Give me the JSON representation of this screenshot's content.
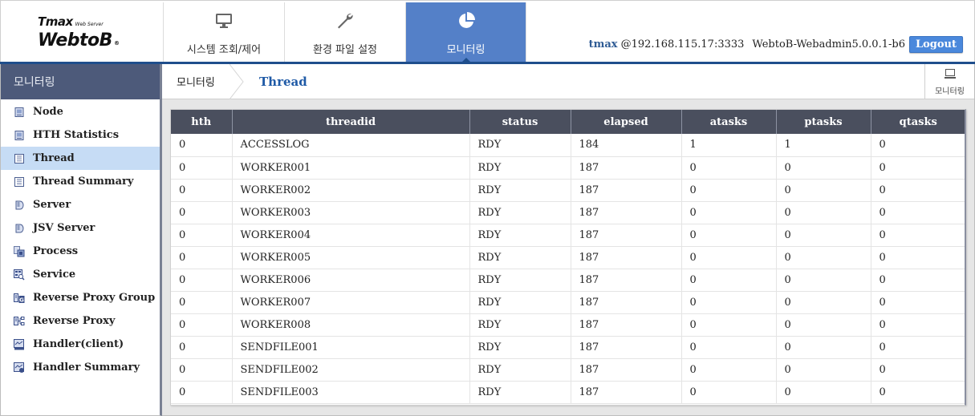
{
  "logo": {
    "brand": "Tmax",
    "tagline": "Web Server",
    "product": "WebtoB",
    "mark": "®"
  },
  "nav": {
    "tabs": [
      {
        "label": "시스템 조회/제어",
        "icon": "monitor-icon",
        "active": false
      },
      {
        "label": "환경 파일 설정",
        "icon": "wrench-icon",
        "active": false
      },
      {
        "label": "모니터링",
        "icon": "pie-chart-icon",
        "active": true
      }
    ]
  },
  "userinfo": {
    "user": "tmax",
    "host": "@192.168.115.17:3333",
    "version": "WebtoB-Webadmin5.0.0.1-b6",
    "logout_label": "Logout"
  },
  "sidebar": {
    "title": "모니터링",
    "items": [
      {
        "label": "Node",
        "icon": "node-icon",
        "active": false
      },
      {
        "label": "HTH Statistics",
        "icon": "hth-statistics-icon",
        "active": false
      },
      {
        "label": "Thread",
        "icon": "thread-icon",
        "active": true
      },
      {
        "label": "Thread Summary",
        "icon": "thread-summary-icon",
        "active": false
      },
      {
        "label": "Server",
        "icon": "server-icon",
        "active": false
      },
      {
        "label": "JSV Server",
        "icon": "jsv-server-icon",
        "active": false
      },
      {
        "label": "Process",
        "icon": "process-icon",
        "active": false
      },
      {
        "label": "Service",
        "icon": "service-icon",
        "active": false
      },
      {
        "label": "Reverse Proxy Group",
        "icon": "reverse-proxy-group-icon",
        "active": false
      },
      {
        "label": "Reverse Proxy",
        "icon": "reverse-proxy-icon",
        "active": false
      },
      {
        "label": "Handler(client)",
        "icon": "handler-client-icon",
        "active": false
      },
      {
        "label": "Handler Summary",
        "icon": "handler-summary-icon",
        "active": false
      }
    ]
  },
  "breadcrumb": {
    "root": "모니터링",
    "current": "Thread"
  },
  "monitor_button": {
    "label": "모니터링",
    "icon": "monitor-icon"
  },
  "table": {
    "columns": [
      "hth",
      "threadid",
      "status",
      "elapsed",
      "atasks",
      "ptasks",
      "qtasks"
    ],
    "rows": [
      [
        "0",
        "ACCESSLOG",
        "RDY",
        "184",
        "1",
        "1",
        "0"
      ],
      [
        "0",
        "WORKER001",
        "RDY",
        "187",
        "0",
        "0",
        "0"
      ],
      [
        "0",
        "WORKER002",
        "RDY",
        "187",
        "0",
        "0",
        "0"
      ],
      [
        "0",
        "WORKER003",
        "RDY",
        "187",
        "0",
        "0",
        "0"
      ],
      [
        "0",
        "WORKER004",
        "RDY",
        "187",
        "0",
        "0",
        "0"
      ],
      [
        "0",
        "WORKER005",
        "RDY",
        "187",
        "0",
        "0",
        "0"
      ],
      [
        "0",
        "WORKER006",
        "RDY",
        "187",
        "0",
        "0",
        "0"
      ],
      [
        "0",
        "WORKER007",
        "RDY",
        "187",
        "0",
        "0",
        "0"
      ],
      [
        "0",
        "WORKER008",
        "RDY",
        "187",
        "0",
        "0",
        "0"
      ],
      [
        "0",
        "SENDFILE001",
        "RDY",
        "187",
        "0",
        "0",
        "0"
      ],
      [
        "0",
        "SENDFILE002",
        "RDY",
        "187",
        "0",
        "0",
        "0"
      ],
      [
        "0",
        "SENDFILE003",
        "RDY",
        "187",
        "0",
        "0",
        "0"
      ]
    ]
  },
  "colors": {
    "accent": "#5480c8",
    "header_line": "#1f4e8c",
    "sidebar_title": "#4d5a7a",
    "table_header": "#4a4f5e",
    "active_item": "#c6dcf5",
    "logout": "#4a88dc"
  }
}
